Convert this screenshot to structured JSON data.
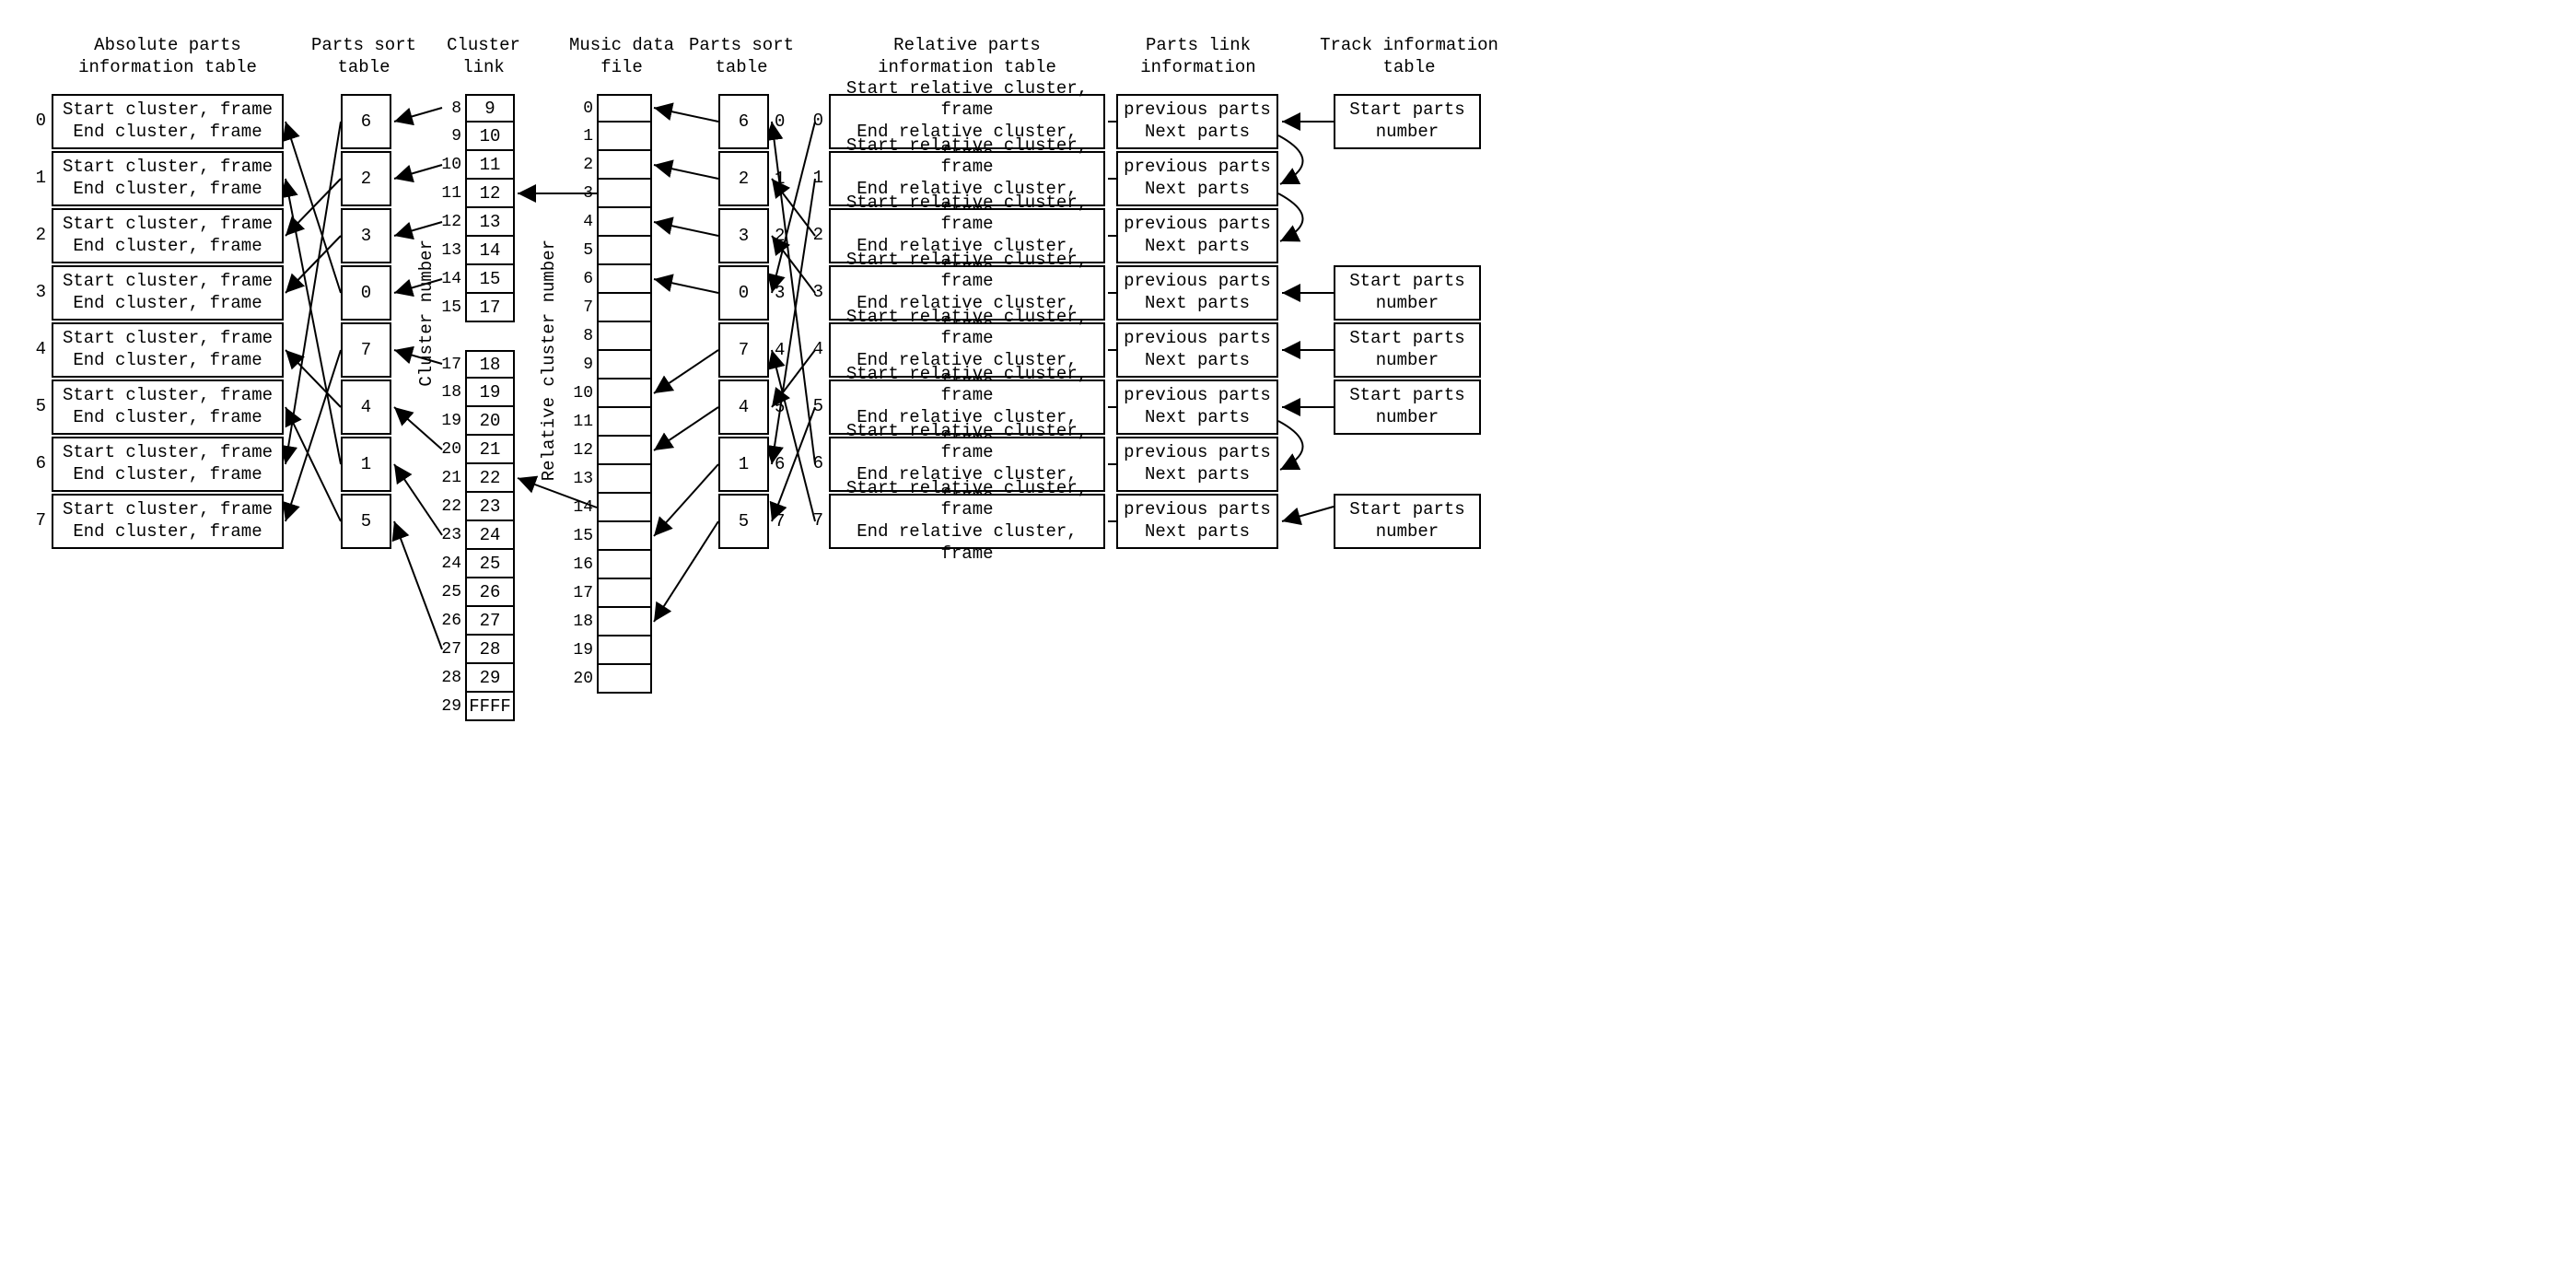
{
  "titles": {
    "absolute": "Absolute parts\ninformation table",
    "sort1": "Parts sort\ntable",
    "cluster": "Cluster\nlink",
    "music": "Music data\nfile",
    "sort2": "Parts sort\ntable",
    "relative": "Relative parts\ninformation table",
    "link": "Parts link\ninformation",
    "track": "Track information\ntable"
  },
  "absolute": {
    "line1": "Start cluster, frame",
    "line2": "End cluster, frame",
    "count": 8
  },
  "sort": [
    "6",
    "2",
    "3",
    "0",
    "7",
    "4",
    "1",
    "5"
  ],
  "cluster": {
    "group1": {
      "labels": [
        "8",
        "9",
        "10",
        "11",
        "12",
        "13",
        "14",
        "15"
      ],
      "values": [
        "9",
        "10",
        "11",
        "12",
        "13",
        "14",
        "15",
        "17"
      ]
    },
    "group2": {
      "labels": [
        "17",
        "18",
        "19",
        "20",
        "21",
        "22",
        "23",
        "24",
        "25",
        "26",
        "27",
        "28",
        "29"
      ],
      "values": [
        "18",
        "19",
        "20",
        "21",
        "22",
        "23",
        "24",
        "25",
        "26",
        "27",
        "28",
        "29",
        "FFFF"
      ]
    },
    "vlabel": "Cluster number"
  },
  "music": {
    "labels": [
      "0",
      "1",
      "2",
      "3",
      "4",
      "5",
      "6",
      "7",
      "8",
      "9",
      "10",
      "11",
      "12",
      "13",
      "14",
      "15",
      "16",
      "17",
      "18",
      "19",
      "20"
    ],
    "vlabel": "Relative cluster number"
  },
  "relative": {
    "line1": "Start relative cluster, frame",
    "line2": "End relative cluster, frame",
    "count": 8
  },
  "link": {
    "line1": "previous parts",
    "line2": "Next parts",
    "count": 8
  },
  "track": {
    "line1": "Start parts",
    "line2": "number"
  }
}
